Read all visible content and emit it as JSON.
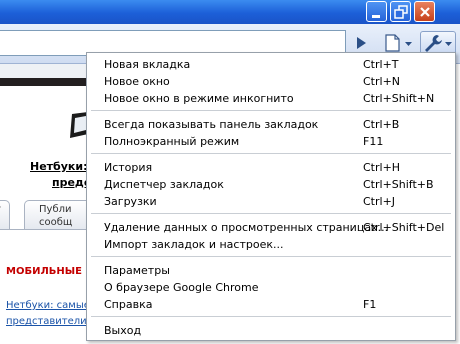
{
  "window": {
    "minimize_icon": "minimize-icon",
    "maximize_icon": "restore-icon",
    "close_icon": "close-icon"
  },
  "toolbar": {
    "go_icon": "play-icon",
    "page_icon": "page-menu-icon",
    "wrench_icon": "wrench-icon"
  },
  "page": {
    "netbook_title": "Нетбуки:",
    "netbook_sub": "предс",
    "tab1": "у",
    "tab2_line1": "Публи",
    "tab2_line2": "сообщ",
    "section_heading": "МОБИЛЬНЫЕ П",
    "link_line1": "Нетбуки: самые",
    "link_line2": "представители"
  },
  "menu": {
    "new_tab": {
      "label": "Новая вкладка",
      "shortcut": "Ctrl+T"
    },
    "new_window": {
      "label": "Новое окно",
      "shortcut": "Ctrl+N"
    },
    "incognito": {
      "label": "Новое окно в режиме инкогнито",
      "shortcut": "Ctrl+Shift+N"
    },
    "bookmarks_bar": {
      "label": "Всегда показывать панель закладок",
      "shortcut": "Ctrl+B"
    },
    "fullscreen": {
      "label": "Полноэкранный режим",
      "shortcut": "F11"
    },
    "history": {
      "label": "История",
      "shortcut": "Ctrl+H"
    },
    "bookmark_manager": {
      "label": "Диспетчер закладок",
      "shortcut": "Ctrl+Shift+B"
    },
    "downloads": {
      "label": "Загрузки",
      "shortcut": "Ctrl+J"
    },
    "clear_data": {
      "label": "Удаление данных о просмотренных страницах...",
      "shortcut": "Ctrl+Shift+Del"
    },
    "import": {
      "label": "Импорт закладок и настроек...",
      "shortcut": ""
    },
    "options": {
      "label": "Параметры",
      "shortcut": ""
    },
    "about": {
      "label": "О браузере Google Chrome",
      "shortcut": ""
    },
    "help": {
      "label": "Справка",
      "shortcut": "F1"
    },
    "exit": {
      "label": "Выход",
      "shortcut": ""
    }
  }
}
